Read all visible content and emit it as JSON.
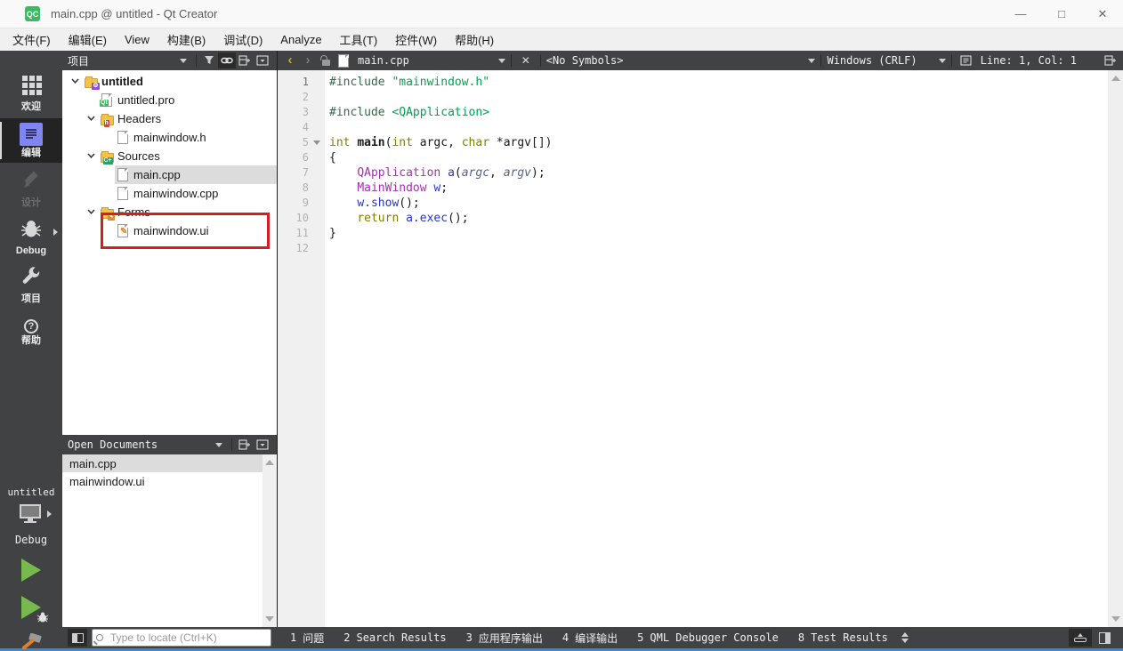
{
  "window": {
    "title": "main.cpp @ untitled - Qt Creator",
    "app_icon_text": "QC",
    "controls": {
      "minimize": "—",
      "maximize": "□",
      "close": "✕"
    }
  },
  "menu": {
    "items": [
      "文件(F)",
      "编辑(E)",
      "View",
      "构建(B)",
      "调试(D)",
      "Analyze",
      "工具(T)",
      "控件(W)",
      "帮助(H)"
    ]
  },
  "mode_sidebar": {
    "items": [
      {
        "label": "欢迎",
        "icon": "welcome-grid-icon",
        "state": "normal"
      },
      {
        "label": "编辑",
        "icon": "edit-document-icon",
        "state": "selected"
      },
      {
        "label": "设计",
        "icon": "design-pencil-icon",
        "state": "disabled"
      },
      {
        "label": "Debug",
        "icon": "debug-bug-icon",
        "state": "normal",
        "has_arrow": true
      },
      {
        "label": "项目",
        "icon": "projects-wrench-icon",
        "state": "normal"
      },
      {
        "label": "帮助",
        "icon": "help-question-icon",
        "state": "normal"
      }
    ],
    "kit": {
      "project": "untitled",
      "build_config": "Debug"
    },
    "accent_color": "#8185f2",
    "run_color": "#77b94f"
  },
  "project_panel": {
    "title": "项目",
    "tree": [
      {
        "label": "untitled",
        "depth": 0,
        "icon": "project-folder",
        "expandable": true,
        "bold": true
      },
      {
        "label": "untitled.pro",
        "depth": 1,
        "icon": "pro-file",
        "expandable": false
      },
      {
        "label": "Headers",
        "depth": 1,
        "icon": "headers-folder",
        "expandable": true
      },
      {
        "label": "mainwindow.h",
        "depth": 2,
        "icon": "file",
        "expandable": false
      },
      {
        "label": "Sources",
        "depth": 1,
        "icon": "sources-folder",
        "expandable": true
      },
      {
        "label": "main.cpp",
        "depth": 2,
        "icon": "file",
        "expandable": false,
        "selected": true
      },
      {
        "label": "mainwindow.cpp",
        "depth": 2,
        "icon": "file",
        "expandable": false
      },
      {
        "label": "Forms",
        "depth": 1,
        "icon": "forms-folder",
        "expandable": true
      },
      {
        "label": "mainwindow.ui",
        "depth": 2,
        "icon": "ui-file",
        "expandable": false,
        "annotated": true
      }
    ],
    "annotation_color": "#d21f1f"
  },
  "open_documents": {
    "title": "Open Documents",
    "items": [
      {
        "label": "main.cpp",
        "selected": true
      },
      {
        "label": "mainwindow.ui",
        "selected": false
      }
    ]
  },
  "editor": {
    "toolbar": {
      "file_name": "main.cpp",
      "symbols": "<No Symbols>",
      "line_ending": "Windows (CRLF)",
      "cursor_position": "Line: 1, Col: 1"
    },
    "code": {
      "language": "cpp",
      "lines": [
        {
          "n": 1,
          "tokens": [
            [
              "pre",
              "#include"
            ],
            [
              "pl",
              " "
            ],
            [
              "str",
              "\"mainwindow.h\""
            ]
          ]
        },
        {
          "n": 2,
          "tokens": []
        },
        {
          "n": 3,
          "tokens": [
            [
              "pre",
              "#include"
            ],
            [
              "pl",
              " "
            ],
            [
              "str",
              "<QApplication>"
            ]
          ]
        },
        {
          "n": 4,
          "tokens": []
        },
        {
          "n": 5,
          "fold": true,
          "tokens": [
            [
              "kw",
              "int"
            ],
            [
              "pl",
              " "
            ],
            [
              "fn",
              "main"
            ],
            [
              "pl",
              "("
            ],
            [
              "kw",
              "int"
            ],
            [
              "pl",
              " argc, "
            ],
            [
              "kw",
              "char"
            ],
            [
              "pl",
              " *argv[])"
            ]
          ]
        },
        {
          "n": 6,
          "tokens": [
            [
              "pl",
              "{"
            ]
          ]
        },
        {
          "n": 7,
          "tokens": [
            [
              "pl",
              "    "
            ],
            [
              "type",
              "QApplication"
            ],
            [
              "pl",
              " "
            ],
            [
              "var",
              "a"
            ],
            [
              "pl",
              "("
            ],
            [
              "param",
              "argc"
            ],
            [
              "pl",
              ", "
            ],
            [
              "param",
              "argv"
            ],
            [
              "pl",
              ");"
            ]
          ]
        },
        {
          "n": 8,
          "tokens": [
            [
              "pl",
              "    "
            ],
            [
              "type",
              "MainWindow"
            ],
            [
              "pl",
              " "
            ],
            [
              "var",
              "w"
            ],
            [
              "pl",
              ";"
            ]
          ]
        },
        {
          "n": 9,
          "tokens": [
            [
              "pl",
              "    "
            ],
            [
              "var",
              "w.show"
            ],
            [
              "pl",
              "();"
            ]
          ]
        },
        {
          "n": 10,
          "tokens": [
            [
              "pl",
              "    "
            ],
            [
              "kw",
              "return"
            ],
            [
              "pl",
              " "
            ],
            [
              "var",
              "a.exec"
            ],
            [
              "pl",
              "();"
            ]
          ]
        },
        {
          "n": 11,
          "tokens": [
            [
              "pl",
              "}"
            ]
          ]
        },
        {
          "n": 12,
          "tokens": []
        }
      ],
      "current_line": 1
    }
  },
  "statusbar": {
    "locator_placeholder": "Type to locate (Ctrl+K)",
    "panes": [
      {
        "index": "1",
        "label": "问题"
      },
      {
        "index": "2",
        "label": "Search Results"
      },
      {
        "index": "3",
        "label": "应用程序输出"
      },
      {
        "index": "4",
        "label": "编译输出"
      },
      {
        "index": "5",
        "label": "QML Debugger Console"
      },
      {
        "index": "8",
        "label": "Test Results"
      }
    ]
  },
  "colors": {
    "chrome_dark": "#404244",
    "selection_gray": "#dcdcdc",
    "annotation_red": "#d21f1f",
    "window_edge_blue": "#3f86c9",
    "code_preprocessor": "#2f6b49",
    "code_string": "#00a14e",
    "code_keyword": "#7f7f00",
    "code_type": "#a22fae",
    "code_variable": "#2436c4"
  }
}
